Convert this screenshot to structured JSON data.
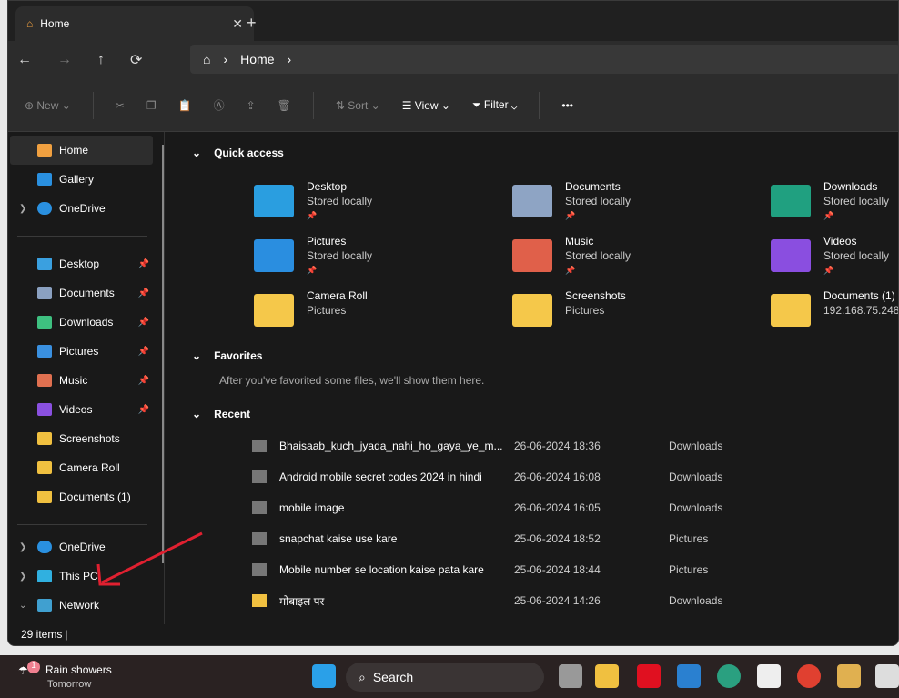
{
  "tab": {
    "title": "Home",
    "close": "✕",
    "new": "+"
  },
  "nav": {
    "back": "←",
    "forward": "→",
    "up": "↑",
    "refresh": "⟳",
    "breadcrumb": "Home"
  },
  "toolbar": {
    "new": "New",
    "sort": "Sort",
    "view": "View",
    "filter": "Filter",
    "more": "•••"
  },
  "sidebar": {
    "top": [
      {
        "label": "Home"
      },
      {
        "label": "Gallery"
      },
      {
        "label": "OneDrive"
      }
    ],
    "pinned": [
      {
        "label": "Desktop",
        "color": "#3aa0e0"
      },
      {
        "label": "Documents",
        "color": "#8aa0c0"
      },
      {
        "label": "Downloads",
        "color": "#3ec080"
      },
      {
        "label": "Pictures",
        "color": "#3a90e0"
      },
      {
        "label": "Music",
        "color": "#e07050"
      },
      {
        "label": "Videos",
        "color": "#8a50e0"
      },
      {
        "label": "Screenshots",
        "color": "#f0c040"
      },
      {
        "label": "Camera Roll",
        "color": "#f0c040"
      },
      {
        "label": "Documents (1)",
        "color": "#f0c040"
      }
    ],
    "bottom": [
      {
        "label": "OneDrive"
      },
      {
        "label": "This PC"
      },
      {
        "label": "Network"
      }
    ]
  },
  "quick_access": {
    "title": "Quick access",
    "items": [
      {
        "name": "Desktop",
        "sub": "Stored locally",
        "color": "#2a9ee0"
      },
      {
        "name": "Documents",
        "sub": "Stored locally",
        "color": "#8ea4c4"
      },
      {
        "name": "Downloads",
        "sub": "Stored locally",
        "color": "#20a080"
      },
      {
        "name": "Pictures",
        "sub": "Stored locally",
        "color": "#2a8ee0"
      },
      {
        "name": "Music",
        "sub": "Stored locally",
        "color": "#e0604a"
      },
      {
        "name": "Videos",
        "sub": "Stored locally",
        "color": "#8a4ee0"
      },
      {
        "name": "Camera Roll",
        "sub": "Pictures",
        "color": "#f5c84a"
      },
      {
        "name": "Screenshots",
        "sub": "Pictures",
        "color": "#f5c84a"
      },
      {
        "name": "Documents (1)",
        "sub": "192.168.75.248",
        "color": "#f5c84a"
      }
    ]
  },
  "favorites": {
    "title": "Favorites",
    "empty": "After you've favorited some files, we'll show them here."
  },
  "recent": {
    "title": "Recent",
    "rows": [
      {
        "name": "Bhaisaab_kuch_jyada_nahi_ho_gaya_ye_m...",
        "date": "26-06-2024 18:36",
        "loc": "Downloads"
      },
      {
        "name": "Android mobile secret codes 2024 in hindi",
        "date": "26-06-2024 16:08",
        "loc": "Downloads"
      },
      {
        "name": "mobile image",
        "date": "26-06-2024 16:05",
        "loc": "Downloads"
      },
      {
        "name": "snapchat kaise use kare",
        "date": "25-06-2024 18:52",
        "loc": "Pictures"
      },
      {
        "name": "Mobile number se location kaise pata kare",
        "date": "25-06-2024 18:44",
        "loc": "Pictures"
      },
      {
        "name": "मोबाइल पर",
        "date": "25-06-2024 14:26",
        "loc": "Downloads"
      }
    ]
  },
  "status": {
    "count": "29 items"
  },
  "taskbar": {
    "weather": "Rain showers",
    "weather_sub": "Tomorrow",
    "badge": "1",
    "search": "Search"
  }
}
